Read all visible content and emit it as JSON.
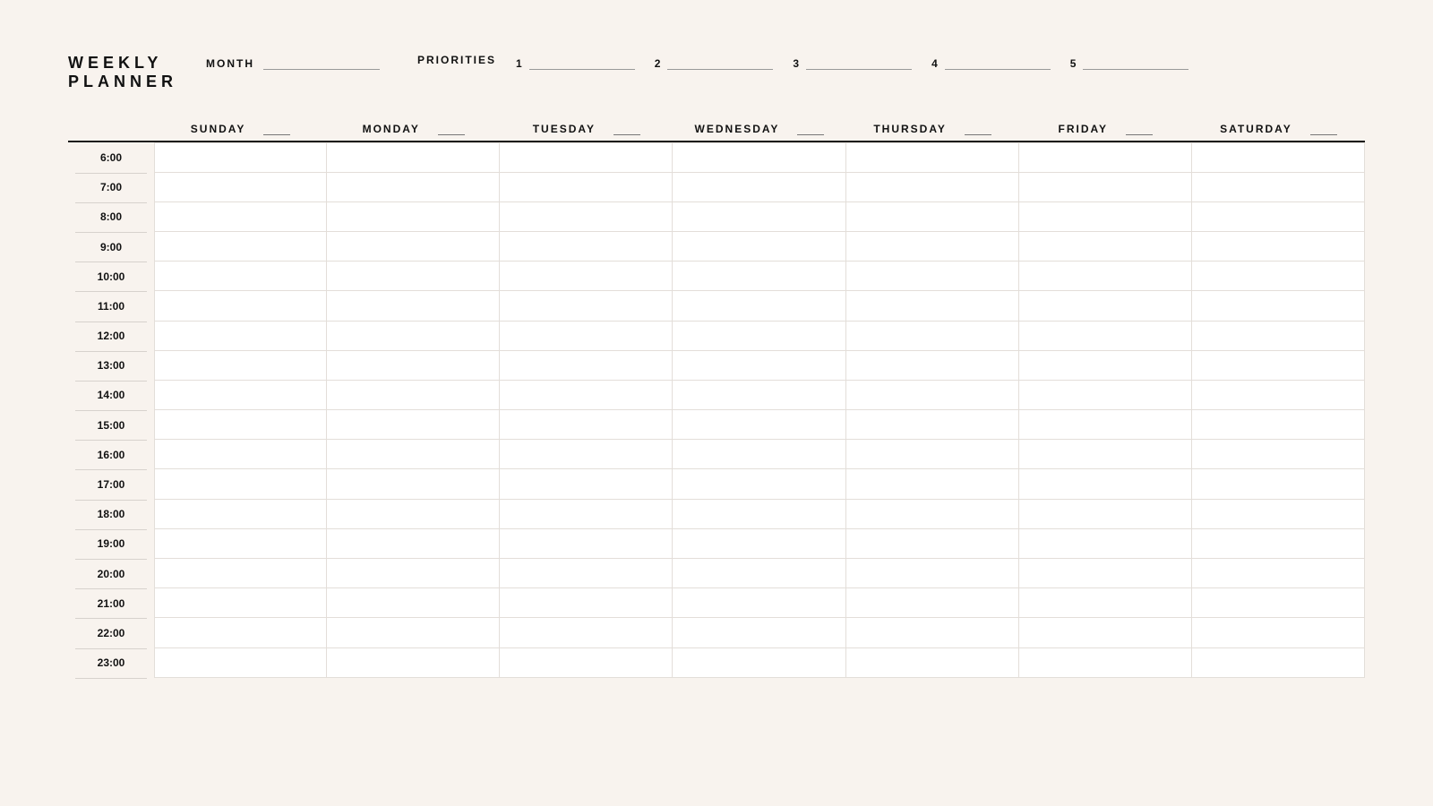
{
  "title": {
    "line1": "WEEKLY",
    "line2": "PLANNER"
  },
  "month_label": "MONTH",
  "month_value": "",
  "priorities_label": "PRIORITIES",
  "priorities": [
    {
      "num": "1",
      "value": ""
    },
    {
      "num": "2",
      "value": ""
    },
    {
      "num": "3",
      "value": ""
    },
    {
      "num": "4",
      "value": ""
    },
    {
      "num": "5",
      "value": ""
    }
  ],
  "days": [
    {
      "label": "SUNDAY",
      "date": ""
    },
    {
      "label": "MONDAY",
      "date": ""
    },
    {
      "label": "TUESDAY",
      "date": ""
    },
    {
      "label": "WEDNESDAY",
      "date": ""
    },
    {
      "label": "THURSDAY",
      "date": ""
    },
    {
      "label": "FRIDAY",
      "date": ""
    },
    {
      "label": "SATURDAY",
      "date": ""
    }
  ],
  "hours": [
    "6:00",
    "7:00",
    "8:00",
    "9:00",
    "10:00",
    "11:00",
    "12:00",
    "13:00",
    "14:00",
    "15:00",
    "16:00",
    "17:00",
    "18:00",
    "19:00",
    "20:00",
    "21:00",
    "22:00",
    "23:00"
  ]
}
